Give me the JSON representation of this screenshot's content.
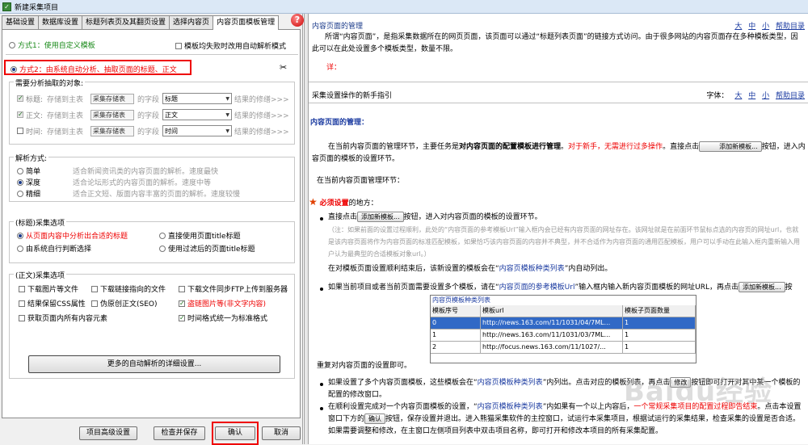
{
  "window": {
    "title": "新建采集项目"
  },
  "tabs": [
    {
      "label": "基础设置"
    },
    {
      "label": "数据库设置"
    },
    {
      "label": "标题列表页及其翻页设置"
    },
    {
      "label": "选择内容页"
    },
    {
      "label": "内容页面模板管理"
    }
  ],
  "mode1": {
    "label": "方式1：使用自定义模板",
    "checkbox_label": "模板均失败时改用自动解析模式"
  },
  "mode2": {
    "label": "方式2：由系统自动分析、抽取页面的标题、正文"
  },
  "objects": {
    "label": "需要分析抽取的对象:",
    "rows": [
      {
        "name": "标题:",
        "store_to": "存储到主表",
        "table": "采集存储表",
        "field_word": "的字段",
        "field": "标题",
        "link": "结果的修缮>>>"
      },
      {
        "name": "正文:",
        "store_to": "存储到主表",
        "table": "采集存储表",
        "field_word": "的字段",
        "field": "正文",
        "link": "结果的修缮>>>"
      },
      {
        "name": "时间:",
        "store_to": "存储到主表",
        "table": "采集存储表",
        "field_word": "的字段",
        "field": "时间",
        "link": "结果的修缮>>>"
      }
    ]
  },
  "parse": {
    "label": "解析方式:",
    "options": [
      {
        "name": "简单",
        "desc": "适合新闻资讯类的内容页面的解析。速度最快"
      },
      {
        "name": "深度",
        "desc": "适合论坛形式的内容页面的解析。速度中等"
      },
      {
        "name": "精细",
        "desc": "适合正文短、版面内容丰富的页面的解析。速度较慢"
      }
    ]
  },
  "title_opts": {
    "label": "(标题)采集选项",
    "options": [
      {
        "label": "从页面内容中分析出合适的标题"
      },
      {
        "label": "直接使用页面title标题"
      },
      {
        "label": "由系统自行判断选择"
      },
      {
        "label": "使用过滤后的页面title标题"
      }
    ]
  },
  "body_opts": {
    "label": "(正文)采集选项",
    "items": [
      {
        "label": "下载图片等文件"
      },
      {
        "label": "下载链接指向的文件"
      },
      {
        "label": "下载文件同步FTP上传到服务器"
      },
      {
        "label": "结果保留CSS属性"
      },
      {
        "label": "伪原创正文(SEO)"
      },
      {
        "label": "盗链图片等(非文字内容)"
      },
      {
        "label": "获取页面内所有内容元素"
      },
      {
        "label": "时间格式统一为标准格式"
      }
    ],
    "more_button": "更多的自动解析的详细设置..."
  },
  "footer": {
    "advanced": "项目高级设置",
    "check_save": "检查并保存",
    "ok": "确认",
    "cancel": "取消"
  },
  "help": {
    "header_title": "内容页面的管理",
    "sizes": [
      "大",
      "中",
      "小"
    ],
    "help_link": "帮助目录",
    "intro": "所谓“内容页面”，是指采集数据所在的网页页面，该页面可以通过“标题列表页面”的链接方式访问。由于很多网站的内容页面存在多种模板类型，因此可以在此处设置多个模板类型，数量不限。",
    "detail": "详：",
    "guide_title": "采集设置操作的新手指引",
    "font_label": "字体：",
    "section_title": "内容页面的管理：",
    "p1a": "在当前内容页面的管理环节，主要任务是",
    "p1b": "对内容页面的配置模板进行管理",
    "p1c": "。",
    "p1d": "对于新手，无需进行过多操作",
    "p1e": "。直接点击",
    "p1f": "按钮，进入内容页面的模板的设置环节。",
    "add_tpl": "添加新模板...",
    "p2": "在当前内容页面管理环节：",
    "must": "必须设置",
    "must_tail": "的地方：",
    "b1a": "直接点击",
    "b1b": "按钮，进入对内容页面的模板的设置环节。",
    "b1note": "（注：如果前面的设置过程顺利，此处的“内容页面的参考模板Url”输入框内会已经有内容页面的网址存在。该网址就是在前面环节鼠标点选的内容页的网址url，也就是该内容页面将作为内容页面的标准匹配模板，如果恰巧该内容页面的内容并不典型，并不合适作为内容页面的通用匹配模板，用户可以手动在此输入框内重新输入用户认为最典型的合适模板对象url。）",
    "b1end_a": "在对模板页面设置顺利结束后，该新设置的模板会在“",
    "b1end_b": "内容页模板种类列表",
    "b1end_c": "”内自动列出。",
    "b2a": "如果当前项目或者当前页面需要设置多个模板，请在“",
    "b2b": "内容页面的参考模板Url",
    "b2c": "”输入框内输入新内容页面模板的网址URL，再点击",
    "b2d": "按",
    "grid_title": "内容页模板种类列表",
    "grid_head": [
      "模板序号",
      "模板url",
      "模板子页面数量"
    ],
    "grid_rows": [
      [
        "0",
        "http://news.163.com/11/1031/04/7ML...",
        "1"
      ],
      [
        "1",
        "http://news.163.com/11/1031/03/7ML...",
        "1"
      ],
      [
        "2",
        "http://focus.news.163.com/11/1027/...",
        "1"
      ]
    ],
    "repeat": "重复对内容页面的设置即可。",
    "b3a": "如果设置了多个内容页面模板，这些模板会在“",
    "b3b": "内容页模板种类列表",
    "b3c": "”内列出。点击对应的模板列表，再点击",
    "b3d": "修改",
    "b3e": "按钮即可打开对其中某一个模板的配置的修改窗口。",
    "b4a": "在顺利设置完成对一个内容页面模板的设置，“",
    "b4b": "内容页模板种类列表",
    "b4c": "”内如果有一个以上内容后，",
    "b4d": "一个常规采集项目的配置过程即告结束",
    "b4e": "。点击本设置窗口下方的",
    "b4f": "确认",
    "b4g": "按钮，保存设置并退出。进入熊猫采集软件的主控窗口，试运行本采集项目，根据试运行的采集结果，检查采集的设置是否合适。",
    "b4h": "如果需要调整和修改，在主窗口左侧项目列表中双击项目名称，即可打开和修改本项目的所有采集配置。",
    "watermark": "Baidu经验"
  }
}
